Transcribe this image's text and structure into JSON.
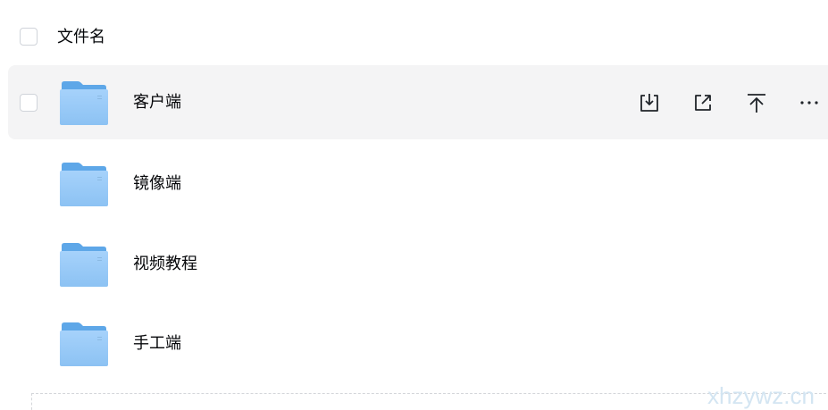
{
  "header": {
    "column_label": "文件名"
  },
  "files": [
    {
      "name": "客户端",
      "icon": "folder-icon",
      "hovered": true
    },
    {
      "name": "镜像端",
      "icon": "folder-icon",
      "hovered": false
    },
    {
      "name": "视频教程",
      "icon": "folder-icon",
      "hovered": false
    },
    {
      "name": "手工端",
      "icon": "folder-icon",
      "hovered": false
    }
  ],
  "row_actions": {
    "download": "download-icon",
    "share": "share-icon",
    "pin_top": "pin-top-icon",
    "more": "more-icon"
  },
  "watermark": "xhzywz.cn",
  "colors": {
    "hover_background": "#f4f4f5",
    "folder_blue": "#6cb3ee",
    "text": "#06070a",
    "watermark": "#d3e5f2"
  }
}
